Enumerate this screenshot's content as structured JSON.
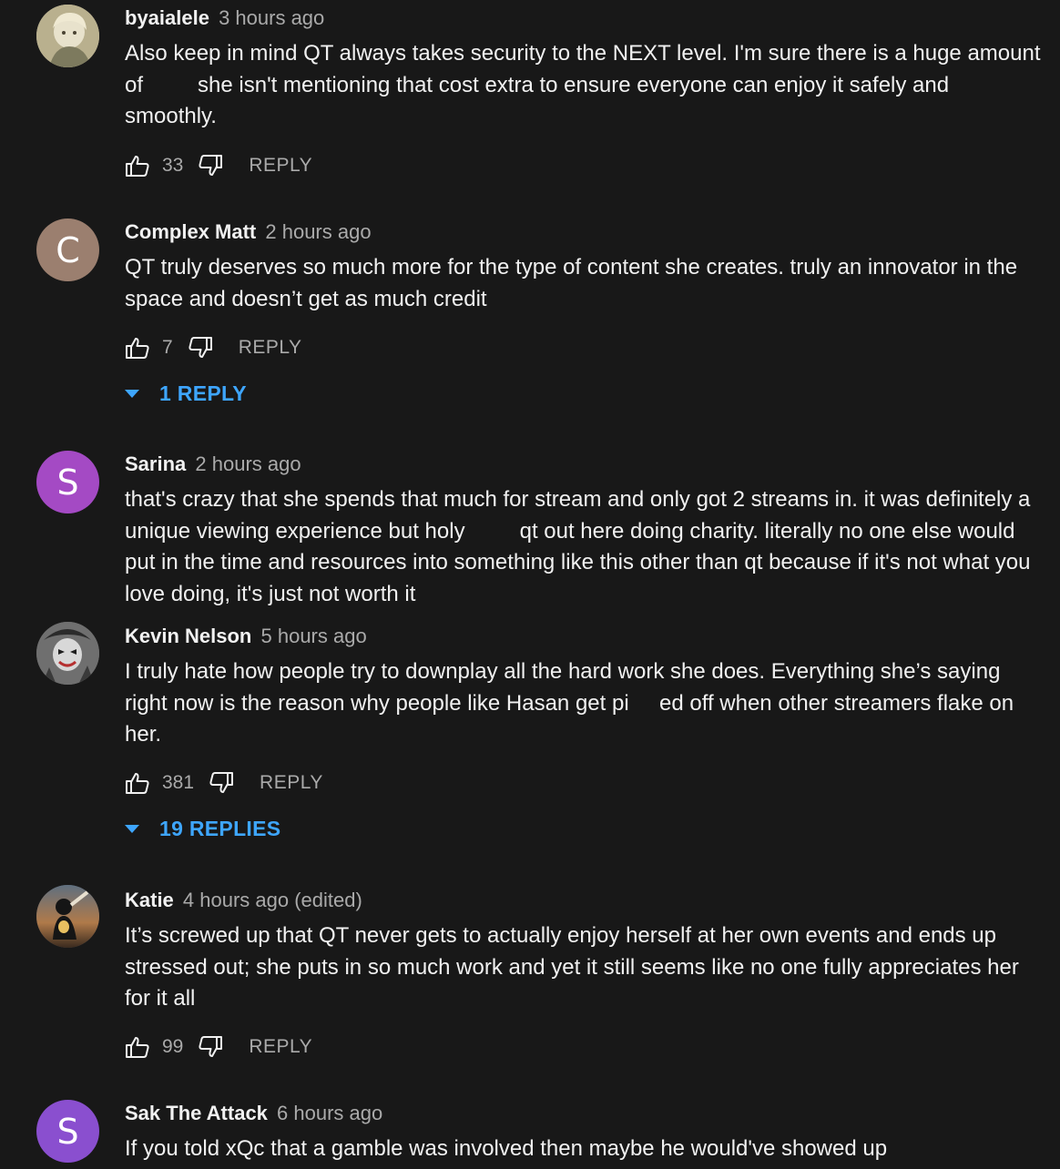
{
  "colors": {
    "background": "#181818",
    "text": "#f1f1f1",
    "muted": "#aaaaaa",
    "link": "#3ea6ff",
    "avatar_brown": "#9b7f6f",
    "avatar_purple": "#a44ac4"
  },
  "comments": [
    {
      "author": "byaialele",
      "time": "3 hours ago",
      "text": "Also keep in mind QT always takes security to the NEXT level. I'm sure there is a huge amount\nof         she isn't mentioning that cost extra to ensure everyone can enjoy it safely and\nsmoothly.",
      "likes": "33",
      "reply_label": "REPLY",
      "avatar_icon": "photo-avatar"
    },
    {
      "author": "Complex Matt",
      "time": "2 hours ago",
      "text": "QT truly deserves so much more for the type of content she creates. truly an innovator in the\nspace and doesn’t get as much credit",
      "likes": "7",
      "reply_label": "REPLY",
      "avatar_letter": "C",
      "replies_label": "1 REPLY"
    },
    {
      "author": "Sarina",
      "time": "2 hours ago",
      "text": "that's crazy that she spends that much for stream and only got 2 streams in. it was definitely a\nunique viewing experience but holy         qt out here doing charity. literally no one else would\nput in the time and resources into something like this other than qt because if it's not what you\nlove doing, it's just not worth it",
      "avatar_letter": "S"
    },
    {
      "author": "Kevin Nelson",
      "time": "5 hours ago",
      "text": "I truly hate how people try to downplay all the hard work she does. Everything she’s saying\nright now is the reason why people like Hasan get pi     ed off when other streamers flake on\nher.",
      "likes": "381",
      "reply_label": "REPLY",
      "avatar_icon": "photo-avatar",
      "replies_label": "19 REPLIES"
    },
    {
      "author": "Katie",
      "time": "4 hours ago (edited)",
      "text": "It’s screwed up that QT never gets to actually enjoy herself at her own events and ends up\nstressed out; she puts in so much work and yet it still seems like no one fully appreciates her\nfor it all",
      "likes": "99",
      "reply_label": "REPLY",
      "avatar_icon": "photo-avatar"
    },
    {
      "author": "Sak The Attack",
      "time": "6 hours ago",
      "text": "If you told xQc that a gamble was involved then maybe he would've showed up",
      "avatar_letter": "S"
    }
  ]
}
